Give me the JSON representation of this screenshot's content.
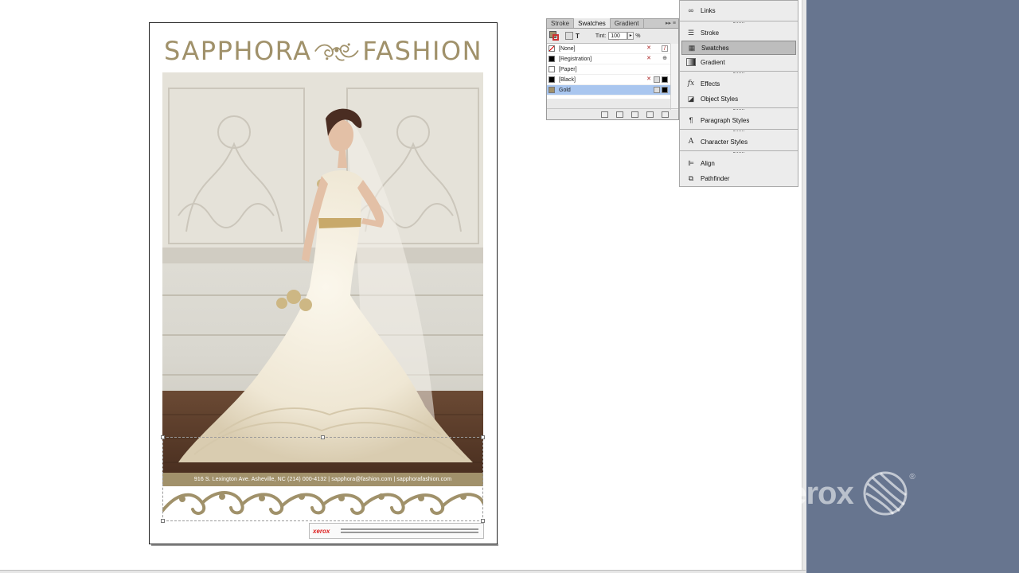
{
  "document": {
    "brand_left": "SAPPHORA",
    "brand_right": "FASHION",
    "footer_text": "916 S. Lexington Ave. Asheville, NC (214) 000-4132 | sapphora@fashion.com | sapphorafashion.com",
    "ad_badge": "xerox",
    "brand_color": "#a0916a"
  },
  "swatches_panel": {
    "tabs": [
      "Stroke",
      "Swatches",
      "Gradient"
    ],
    "active_tab": "Swatches",
    "tint_label": "Tint:",
    "tint_value": "100",
    "tint_unit": "%",
    "swatches": [
      {
        "name": "[None]",
        "color": "none"
      },
      {
        "name": "[Registration]",
        "color": "#000000"
      },
      {
        "name": "[Paper]",
        "color": "#ffffff"
      },
      {
        "name": "[Black]",
        "color": "#000000"
      },
      {
        "name": "Gold",
        "color": "#a1916b",
        "selected": true
      }
    ]
  },
  "dock": {
    "items": [
      {
        "label": "Links",
        "icon": "links-icon"
      },
      {
        "label": "Stroke",
        "icon": "stroke-icon"
      },
      {
        "label": "Swatches",
        "icon": "swatches-icon",
        "active": true
      },
      {
        "label": "Gradient",
        "icon": "gradient-icon"
      },
      {
        "label": "Effects",
        "icon": "effects-icon"
      },
      {
        "label": "Object Styles",
        "icon": "object-styles-icon"
      },
      {
        "label": "Paragraph Styles",
        "icon": "paragraph-styles-icon"
      },
      {
        "label": "Character Styles",
        "icon": "character-styles-icon"
      },
      {
        "label": "Align",
        "icon": "align-icon"
      },
      {
        "label": "Pathfinder",
        "icon": "pathfinder-icon"
      }
    ]
  },
  "watermark": {
    "text": "xerox",
    "registered": "®"
  },
  "colors": {
    "desktop": "#67758f",
    "selection": "#a9c6ef"
  }
}
